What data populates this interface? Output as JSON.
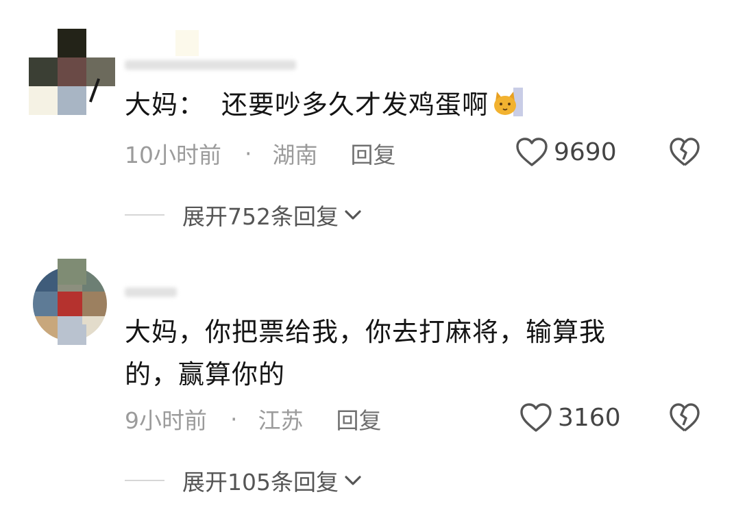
{
  "comments": [
    {
      "text_a": "大妈：",
      "text_b": "还要吵多久才发鸡蛋啊",
      "emoji": "cat-face-emoji",
      "time": "10小时前",
      "separator": "·",
      "location": "湖南",
      "reply_label": "回复",
      "likes": "9690",
      "expand_label": "展开752条回复"
    },
    {
      "line1": "大妈，你把票给我，你去打麻将，输算我",
      "line2": "的，赢算你的",
      "time": "9小时前",
      "separator": "·",
      "location": "江苏",
      "reply_label": "回复",
      "likes": "3160",
      "expand_label": "展开105条回复"
    }
  ],
  "icons": [
    "heart-icon",
    "broken-heart-icon",
    "chevron-down-icon"
  ],
  "colors": {
    "meta_text": "#9b9b9b",
    "body_text": "#141414",
    "icon": "#444444"
  }
}
